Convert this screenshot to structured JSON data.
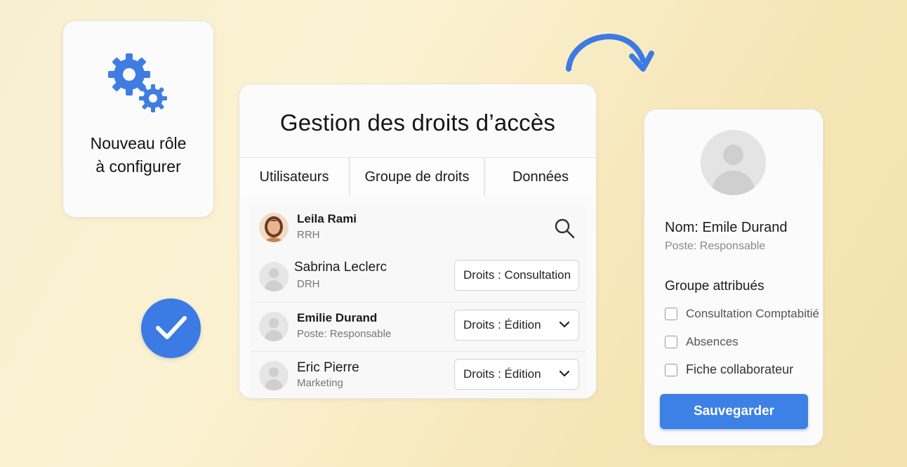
{
  "role_card": {
    "line1": "Nouveau rôle",
    "line2": "à configurer",
    "icon": "gears-icon"
  },
  "main_card": {
    "title": "Gestion des droits d’accès",
    "tabs": [
      "Utilisateurs",
      "Groupe de droits",
      "Données"
    ],
    "users": [
      {
        "name": "Leila Rami",
        "role": "RRH",
        "rights": ""
      },
      {
        "name": "Sabrina Leclerc",
        "role": "DRH",
        "rights": "Droits : Consultation"
      },
      {
        "name": "Emilie Durand",
        "role": "Poste: Responsable",
        "rights": "Droits : Édition"
      },
      {
        "name": "Eric Pierre",
        "role": "Marketing",
        "rights": "Droits : Édition"
      }
    ]
  },
  "profile_card": {
    "name": "Nom: Emile Durand",
    "post": "Poste: Responsable",
    "groups_title": "Groupe attribués",
    "groups": [
      "Consultation Comptabitié",
      "Absences",
      "Fiche collaborateur"
    ],
    "save_label": "Sauvegarder"
  },
  "colors": {
    "accent": "#3b7be3",
    "background": "#f8efcf"
  }
}
